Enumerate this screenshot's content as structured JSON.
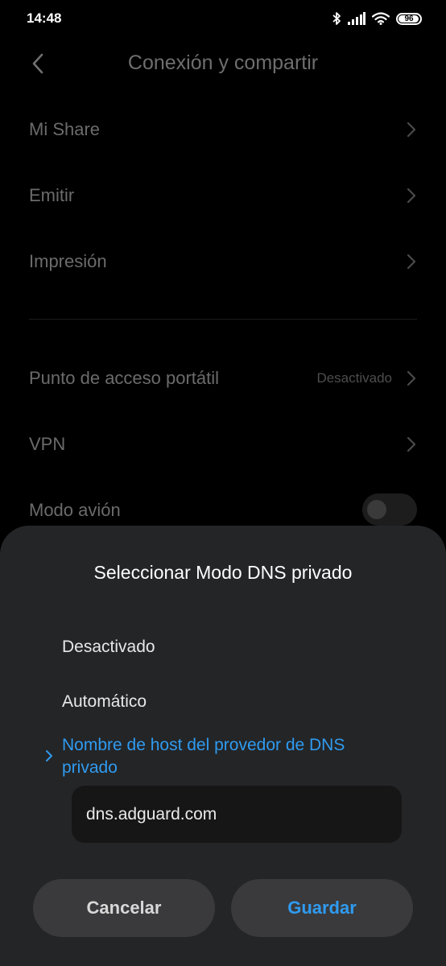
{
  "status_bar": {
    "time": "14:48",
    "battery": "96",
    "battery_level": 0.96,
    "icons": [
      "bluetooth-icon",
      "signal-icon",
      "wifi-icon",
      "battery-icon"
    ]
  },
  "header": {
    "title": "Conexión y compartir",
    "back_icon": "back-arrow-icon"
  },
  "settings": {
    "items": [
      {
        "label": "Mi Share"
      },
      {
        "label": "Emitir"
      },
      {
        "label": "Impresión"
      },
      {
        "label": "Punto de acceso portátil",
        "value": "Desactivado"
      },
      {
        "label": "VPN"
      },
      {
        "label": "Modo avión",
        "toggle": false
      }
    ]
  },
  "dialog": {
    "title": "Seleccionar Modo DNS privado",
    "options": [
      {
        "label": "Desactivado"
      },
      {
        "label": "Automático"
      },
      {
        "label": "Nombre de host del provedor de DNS privado",
        "selected": true
      }
    ],
    "hostname_value": "dns.adguard.com",
    "cancel_label": "Cancelar",
    "save_label": "Guardar"
  },
  "colors": {
    "accent": "#2f9bf0",
    "dialog_background": "#242527",
    "page_background": "#000000"
  }
}
